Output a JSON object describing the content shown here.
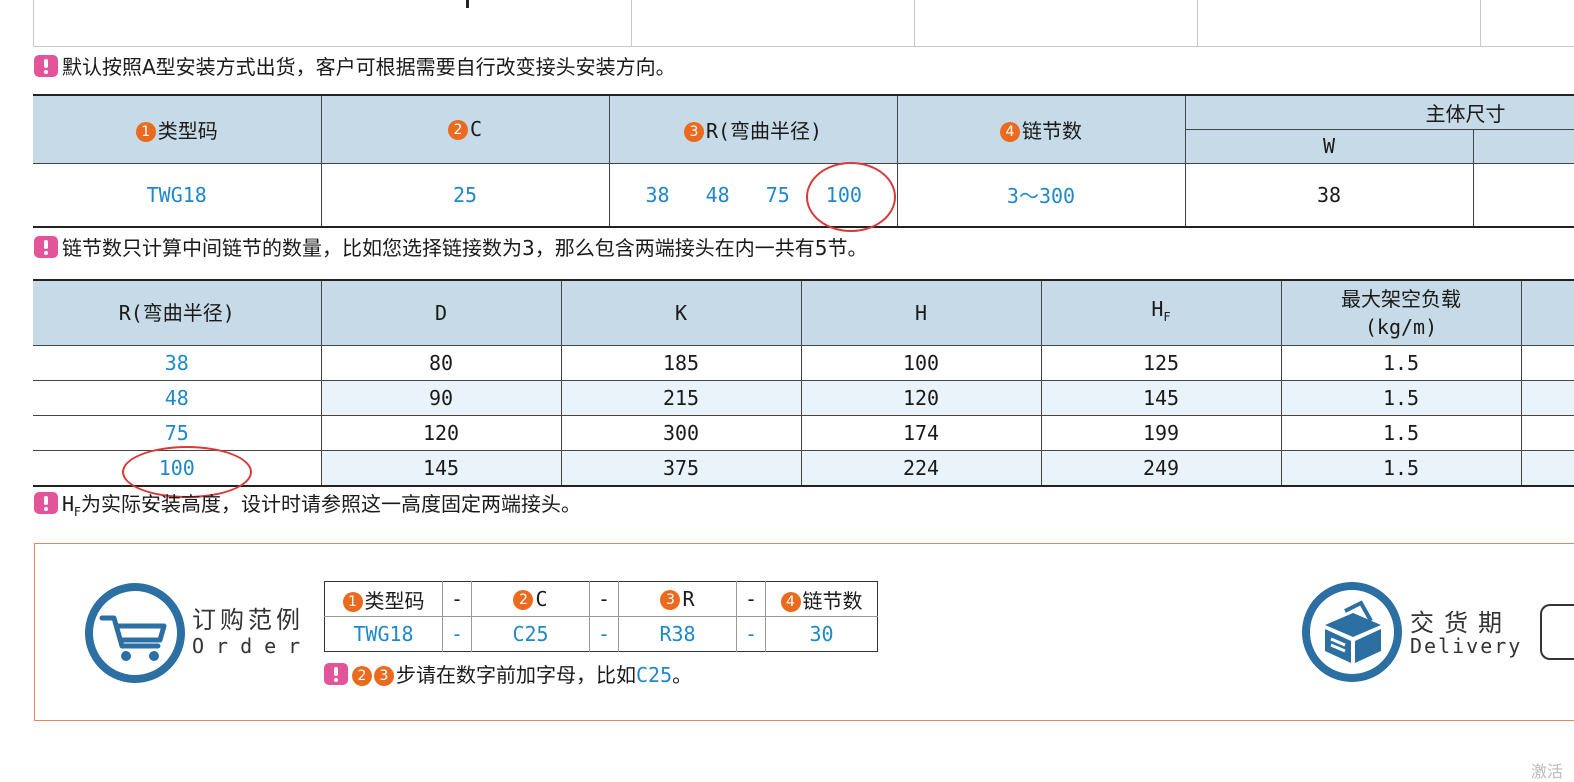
{
  "notes": {
    "install": "默认按照A型安装方式出货，客户可根据需要自行改变接头安装方向。",
    "links": "链节数只计算中间链节的数量，比如您选择链接数为3，那么包含两端接头在内一共有5节。",
    "hf_sym": "H",
    "hf_sub": "F",
    "hf_rest": "为实际安装高度，设计时请参照这一高度固定两端接头。"
  },
  "spec_table": {
    "headers": {
      "type_num": "1",
      "type": "类型码",
      "c_num": "2",
      "c": "C",
      "r_num": "3",
      "r": "R(弯曲半径)",
      "links_num": "4",
      "links": "链节数",
      "main_dims": "主体尺寸",
      "w": "W"
    },
    "row": {
      "type": "TWG18",
      "c": "25",
      "r_values": [
        "38",
        "48",
        "75",
        "100"
      ],
      "links": "3～300",
      "w": "38"
    }
  },
  "dim_table": {
    "headers": {
      "r": "R(弯曲半径)",
      "d": "D",
      "k": "K",
      "h": "H",
      "hf": "H",
      "hf_sub": "F",
      "load_line1": "最大架空负载",
      "load_line2": "(kg/m)"
    },
    "rows": [
      {
        "r": "38",
        "d": "80",
        "k": "185",
        "h": "100",
        "hf": "125",
        "load": "1.5"
      },
      {
        "r": "48",
        "d": "90",
        "k": "215",
        "h": "120",
        "hf": "145",
        "load": "1.5"
      },
      {
        "r": "75",
        "d": "120",
        "k": "300",
        "h": "174",
        "hf": "199",
        "load": "1.5"
      },
      {
        "r": "100",
        "d": "145",
        "k": "375",
        "h": "224",
        "hf": "249",
        "load": "1.5"
      }
    ]
  },
  "order": {
    "title_cn": "订购范例",
    "title_en": "Order",
    "headers": {
      "n1": "1",
      "type": "类型码",
      "n2": "2",
      "c": "C",
      "n3": "3",
      "r": "R",
      "n4": "4",
      "links": "链节数"
    },
    "dash": "-",
    "values": {
      "type": "TWG18",
      "c": "C25",
      "r": "R38",
      "links": "30"
    },
    "note_nums": [
      "2",
      "3"
    ],
    "note_text": "步请在数字前加字母，比如",
    "note_example": "C25",
    "note_end": "。"
  },
  "delivery": {
    "title_cn": "交货期",
    "title_en": "Delivery"
  },
  "watermark": "激活"
}
